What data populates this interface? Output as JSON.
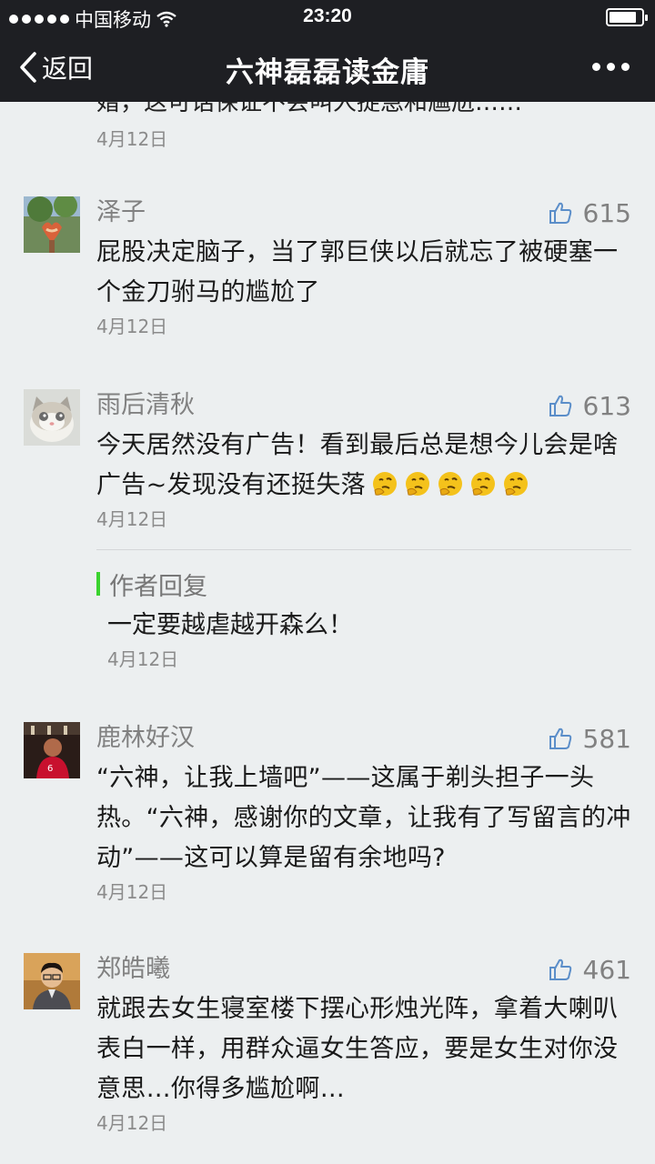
{
  "status_bar": {
    "carrier": "中国移动",
    "time": "23:20",
    "battery_level": 0.85
  },
  "nav": {
    "back_label": "返回",
    "title": "六神磊磊读金庸"
  },
  "partial_comment": {
    "text": "婚，这可话保证不会叫人捉急和尴尬……",
    "date": "4月12日"
  },
  "comments": [
    {
      "name": "泽子",
      "likes": "615",
      "text": "屁股决定脑子，当了郭巨侠以后就忘了被硬塞一个金刀驸马的尴尬了",
      "date": "4月12日"
    },
    {
      "name": "雨后清秋",
      "likes": "613",
      "text": "今天居然没有广告！看到最后总是想今儿会是啥广告~发现没有还挺失落",
      "date": "4月12日",
      "reply": {
        "label": "作者回复",
        "text": "一定要越虐越开森么！",
        "date": "4月12日"
      }
    },
    {
      "name": "鹿林好汉",
      "likes": "581",
      "text": "“六神，让我上墙吧”——这属于剃头担子一头热。“六神，感谢你的文章，让我有了写留言的冲动”——这可以算是留有余地吗?",
      "date": "4月12日"
    },
    {
      "name": "郑皓曦",
      "likes": "461",
      "text": "就跟去女生寝室楼下摆心形烛光阵，拿着大喇叭表白一样，用群众逼女生答应，要是女生对你没意思…你得多尴尬啊…",
      "date": "4月12日"
    }
  ],
  "colors": {
    "bar_bg": "#1e1f23",
    "page_bg": "#eceff0",
    "reply_accent": "#3ad32f",
    "like_icon": "#5b8ec9"
  }
}
